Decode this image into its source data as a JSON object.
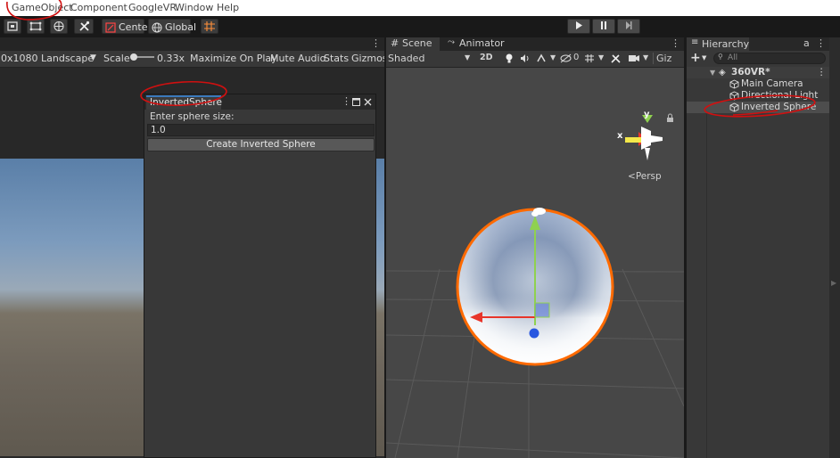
{
  "menu": {
    "items": [
      "GameObject",
      "Component",
      "GoogleVR",
      "Window",
      "Help"
    ]
  },
  "toolbar": {
    "center_label": "Center",
    "global_label": "Global"
  },
  "game_view": {
    "resolution": "0x1080 Landscape",
    "scale_label": "Scale",
    "scale_value": "0.33x",
    "maximize_label": "Maximize On Play",
    "mute_label": "Mute Audio",
    "stats_label": "Stats",
    "gizmos_label": "Gizmos"
  },
  "inverted_sphere_window": {
    "tab_title": "InvertedSphere",
    "size_label": "Enter sphere size:",
    "size_value": "1.0",
    "create_button": "Create Inverted Sphere"
  },
  "scene_view": {
    "tabs": [
      "Scene",
      "Animator"
    ],
    "shading_mode": "Shaded",
    "mode_2d": "2D",
    "hidden_count": "0",
    "gizmos_short": "Giz",
    "axis_y": "y",
    "axis_x": "x",
    "projection": "Persp"
  },
  "hierarchy": {
    "tab": "Hierarchy",
    "search_placeholder": "All",
    "scene_name": "360VR*",
    "items": [
      "Main Camera",
      "Directional Light",
      "Inverted Sphere"
    ]
  },
  "colors": {
    "selection_outline": "#ff6a00",
    "annotation": "#d01010",
    "y_axis": "#8fd14f",
    "x_axis": "#e8352a",
    "z_axis": "#2857e0"
  }
}
